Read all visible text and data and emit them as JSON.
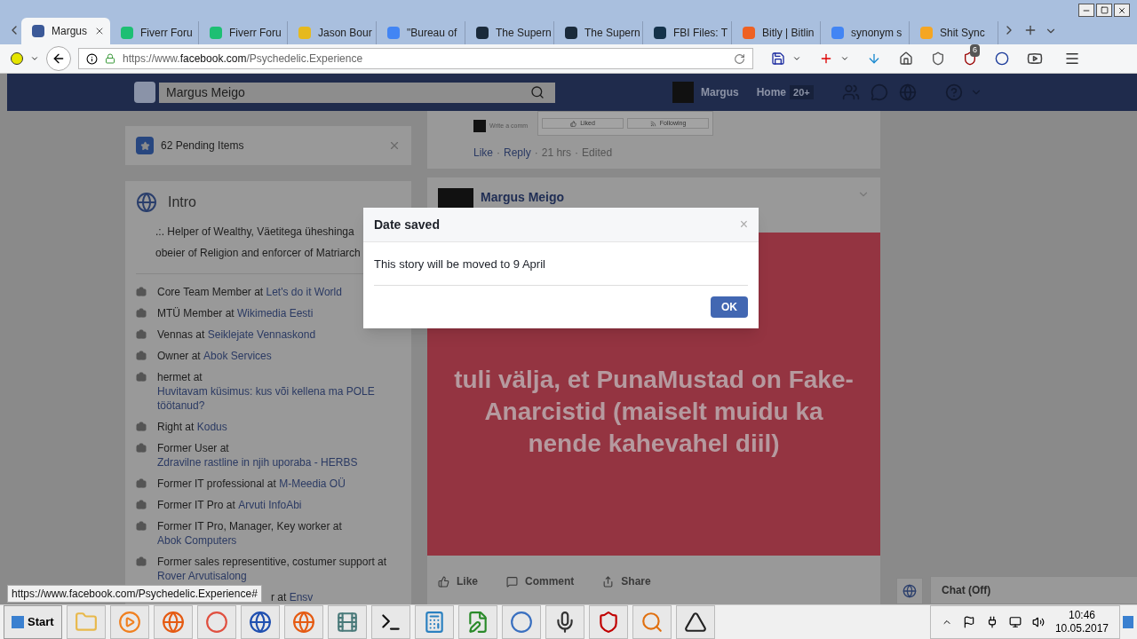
{
  "tabs": [
    {
      "label": "Margus",
      "selected": true,
      "color": "#3b5998"
    },
    {
      "label": "Fiverr Foru",
      "selected": false,
      "color": "#1dbf73"
    },
    {
      "label": "Fiverr Foru",
      "selected": false,
      "color": "#1dbf73"
    },
    {
      "label": "Jason Bour",
      "selected": false,
      "color": "#e6b91e"
    },
    {
      "label": "\"Bureau of",
      "selected": false,
      "color": "#4285f4"
    },
    {
      "label": "The Supern",
      "selected": false,
      "color": "#1a2a3a"
    },
    {
      "label": "The Supern",
      "selected": false,
      "color": "#1a2a3a"
    },
    {
      "label": "FBI Files: T",
      "selected": false,
      "color": "#14324a"
    },
    {
      "label": "Bitly | Bitlin",
      "selected": false,
      "color": "#ee6123"
    },
    {
      "label": "synonym s",
      "selected": false,
      "color": "#4285f4"
    },
    {
      "label": "Shit Sync",
      "selected": false,
      "color": "#f5a623"
    }
  ],
  "address": {
    "prefix": "https://www.",
    "domain": "facebook.com",
    "path": "/Psychedelic.Experience"
  },
  "extension_badge": "6",
  "fb_header": {
    "search_value": "Margus Meigo",
    "profile_name": "Margus",
    "home": "Home",
    "home_count": "20+"
  },
  "pending": {
    "label": "62 Pending Items"
  },
  "intro": {
    "title": "Intro",
    "bio": [
      ".:. Helper of Wealthy, Väetitega üheshinga",
      "obeier of Religion and enforcer of Matriarch"
    ],
    "work": [
      {
        "text": "Core Team Member at ",
        "link": "Let's do it World"
      },
      {
        "text": "MTÜ Member at ",
        "link": "Wikimedia Eesti"
      },
      {
        "text": "Vennas at ",
        "link": "Seiklejate Vennaskond"
      },
      {
        "text": "Owner at ",
        "link": "Abok Services"
      },
      {
        "text": "hermet at ",
        "link": "Huvitavam küsimus: kus või kellena ma POLE töötanud?"
      },
      {
        "text": "Right at ",
        "link": "Kodus"
      },
      {
        "text": "Former User at ",
        "link": "Zdravilne rastline in njih uporaba - HERBS"
      },
      {
        "text": "Former IT professional at ",
        "link": "M-Meedia OÜ"
      },
      {
        "text": "Former IT Pro at ",
        "link": "Arvuti InfoAbi"
      },
      {
        "text": "Former IT Pro, Manager, Key worker at ",
        "link": "Abok Computers"
      },
      {
        "text": "Former sales representitive, costumer support at ",
        "link": "Rover Arvutisalong"
      },
      {
        "text": "r at ",
        "link": "Ensv",
        "kind": "partial"
      }
    ]
  },
  "comment": {
    "separator": "·",
    "placeholder": "Write a comm",
    "liked": "Liked",
    "following": "Following",
    "actions": [
      "Like",
      "Reply"
    ],
    "time": "21 hrs",
    "edited": "Edited"
  },
  "post": {
    "author": "Margus Meigo",
    "text": "tuli välja, et PunaMustad on Fake-Anarcistid (maiselt muidu ka nende kahevahel diil)",
    "actions": [
      "Like",
      "Comment",
      "Share"
    ]
  },
  "chat": {
    "label": "Chat (Off)"
  },
  "dialog": {
    "title": "Date saved",
    "close": "×",
    "message": "This story will be moved to 9 April",
    "button": "OK"
  },
  "status_url": "https://www.facebook.com/Psychedelic.Experience#",
  "taskbar": {
    "start": "Start",
    "time": "10:46",
    "date": "10.05.2017"
  }
}
